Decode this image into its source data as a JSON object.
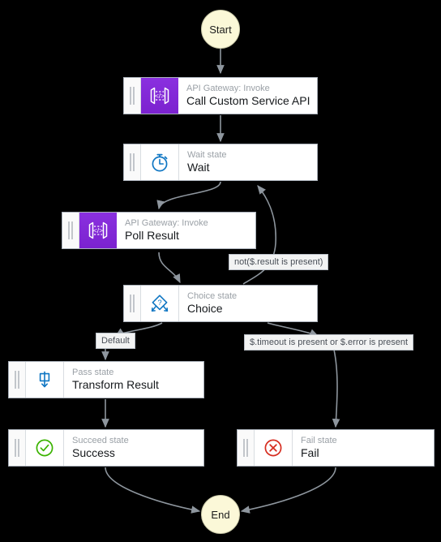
{
  "diagram": {
    "title": "AWS Step Functions state machine graph",
    "background_color": "#000000",
    "edge_color": "#8e969e",
    "terminal_fill": "#fbf8d8",
    "terminal_border": "#c9c8a8",
    "card_fill": "#ffffff",
    "card_border": "#aab1ba",
    "api_gateway_color": "#8a30df",
    "blue_icon_color": "#0f76c3",
    "success_color": "#3bb300",
    "fail_color": "#d62d20"
  },
  "nodes": {
    "start": {
      "label": "Start",
      "type": "start-terminal"
    },
    "call_api": {
      "kind": "API Gateway: Invoke",
      "name": "Call Custom Service API",
      "icon": "api-gateway-icon"
    },
    "wait": {
      "kind": "Wait state",
      "name": "Wait",
      "icon": "stopwatch-icon"
    },
    "poll": {
      "kind": "API Gateway: Invoke",
      "name": "Poll Result",
      "icon": "api-gateway-icon"
    },
    "choice": {
      "kind": "Choice state",
      "name": "Choice",
      "icon": "choice-diamond-icon"
    },
    "transform": {
      "kind": "Pass state",
      "name": "Transform Result",
      "icon": "pass-arrow-icon"
    },
    "success": {
      "kind": "Succeed state",
      "name": "Success",
      "icon": "check-circle-icon"
    },
    "fail": {
      "kind": "Fail state",
      "name": "Fail",
      "icon": "x-circle-icon"
    },
    "end": {
      "label": "End",
      "type": "end-terminal"
    }
  },
  "edge_labels": {
    "not_result": "not($.result is present)",
    "default": "Default",
    "timeout_or_error": "$.timeout is present or $.error is present"
  },
  "edges": [
    {
      "from": "start",
      "to": "call_api",
      "label": ""
    },
    {
      "from": "call_api",
      "to": "wait",
      "label": ""
    },
    {
      "from": "wait",
      "to": "poll",
      "label": ""
    },
    {
      "from": "poll",
      "to": "choice",
      "label": ""
    },
    {
      "from": "choice",
      "to": "wait",
      "label": "not($.result is present)"
    },
    {
      "from": "choice",
      "to": "transform",
      "label": "Default"
    },
    {
      "from": "choice",
      "to": "fail",
      "label": "$.timeout is present or $.error is present"
    },
    {
      "from": "transform",
      "to": "success",
      "label": ""
    },
    {
      "from": "success",
      "to": "end",
      "label": ""
    },
    {
      "from": "fail",
      "to": "end",
      "label": ""
    }
  ]
}
